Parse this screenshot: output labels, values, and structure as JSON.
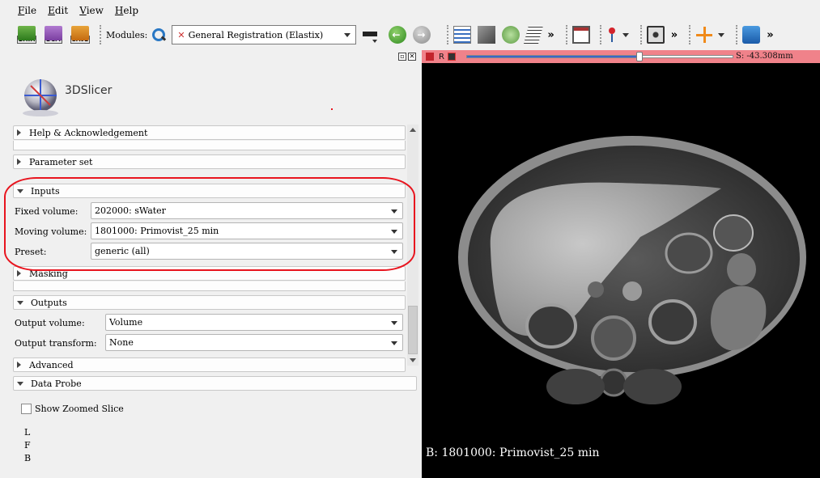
{
  "menu": [
    "File",
    "Edit",
    "View",
    "Help"
  ],
  "toolbar": {
    "data_label": "DATA",
    "dcm_label": "DCM",
    "save_label": "SAVE",
    "modules_label": "Modules:",
    "module_value": "General Registration (Elastix)",
    "more_glyph": "»"
  },
  "app": {
    "logo_text": "3DSlicer"
  },
  "sections": {
    "help": "Help & Acknowledgement",
    "parameter_set": "Parameter set",
    "inputs": "Inputs",
    "masking": "Masking",
    "outputs": "Outputs",
    "advanced": "Advanced",
    "data_probe": "Data Probe"
  },
  "inputs": {
    "fixed_label": "Fixed volume:",
    "fixed_value": "202000: sWater",
    "moving_label": "Moving volume:",
    "moving_value": "1801000: Primovist_25 min",
    "preset_label": "Preset:",
    "preset_value": "generic (all)"
  },
  "outputs": {
    "volume_label": "Output volume:",
    "volume_value": "Volume",
    "transform_label": "Output transform:",
    "transform_value": "None"
  },
  "data_probe": {
    "show_zoomed_label": "Show Zoomed Slice",
    "show_zoomed_checked": false,
    "coords": [
      "L",
      "F",
      "B"
    ]
  },
  "viewer": {
    "orientation": "R",
    "slice_offset": "S: -43.308mm",
    "slider_fraction": 0.65,
    "background_label": "B: 1801000: Primovist_25 min",
    "bar_color": "#f0828a"
  },
  "annotation_color": "#e8141e"
}
